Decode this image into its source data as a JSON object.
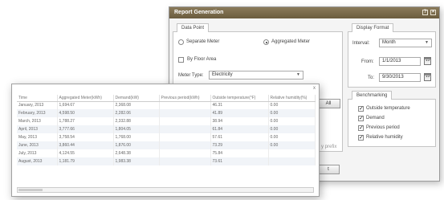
{
  "dialog": {
    "title": "Report Generation",
    "data_point": {
      "tab": "Data Point",
      "separate_meter": "Separate Meter",
      "aggregated_meter": "Aggregated Meter",
      "by_floor_area": "By Floor Area",
      "meter_type_label": "Meter Type:",
      "meter_type_value": "Electricity",
      "all_button": "All",
      "partial_text": "y prefix"
    },
    "display_format": {
      "tab": "Display Format",
      "interval_label": "Interval:",
      "interval_value": "Month",
      "from_label": "From:",
      "from_value": "1/1/2013",
      "to_label": "To:",
      "to_value": "9/30/2013",
      "cal_label": "15"
    },
    "benchmarking": {
      "tab": "Benchmarking",
      "items": [
        {
          "label": "Outside temperature",
          "checked": true
        },
        {
          "label": "Demand",
          "checked": true
        },
        {
          "label": "Previous period",
          "checked": true
        },
        {
          "label": "Relative humidity",
          "checked": true
        }
      ]
    },
    "bottom_button": "t"
  },
  "grid": {
    "close": "x",
    "columns": [
      "Time",
      "Aggregated Meter(kWh)",
      "Demand(kW)",
      "Previous period(kWh)",
      "Outside temperature(°F)",
      "Relative humidity(%)"
    ],
    "rows": [
      [
        "January, 2013",
        "1,694.67",
        "2,368.08",
        "",
        "46.31",
        "0.00"
      ],
      [
        "February, 2013",
        "4,598.50",
        "2,282.06",
        "",
        "41.89",
        "0.00"
      ],
      [
        "March, 2013",
        "1,788.27",
        "2,332.88",
        "",
        "38.94",
        "0.00"
      ],
      [
        "April, 2013",
        "3,777.66",
        "1,804.05",
        "",
        "61.84",
        "0.00"
      ],
      [
        "May, 2013",
        "3,758.54",
        "1,768.00",
        "",
        "57.61",
        "0.00"
      ],
      [
        "June, 2013",
        "3,860.44",
        "1,876.00",
        "",
        "73.29",
        "0.00"
      ],
      [
        "July, 2013",
        "4,124.55",
        "2,648.38",
        "",
        "75.84",
        ""
      ],
      [
        "August, 2013",
        "1,181.79",
        "1,983.38",
        "",
        "73.61",
        ""
      ]
    ]
  }
}
